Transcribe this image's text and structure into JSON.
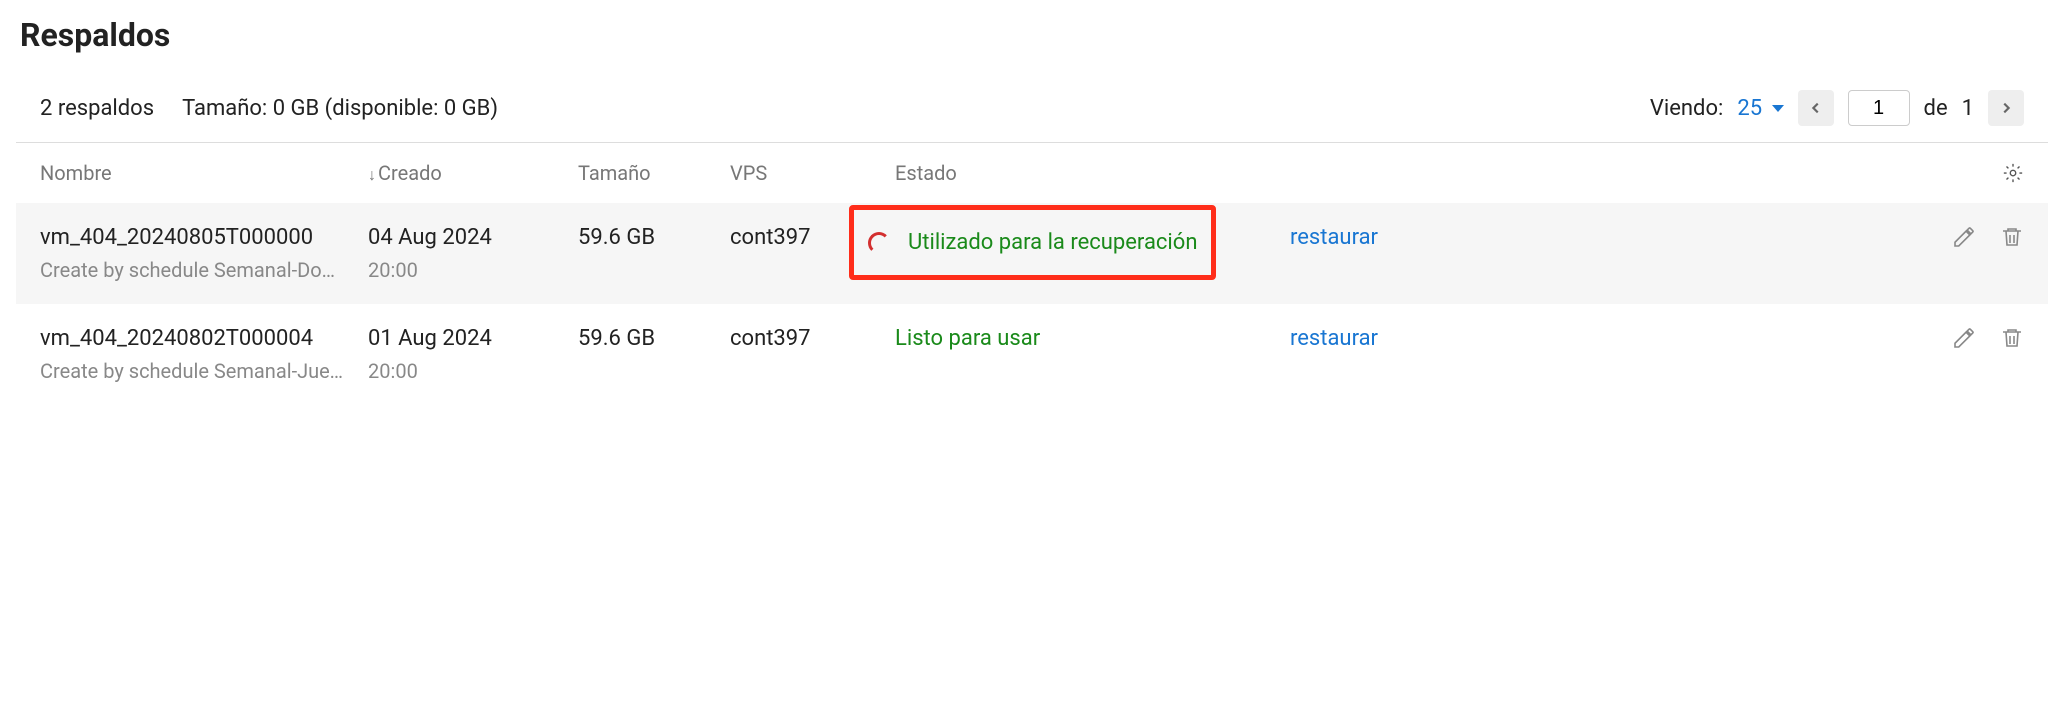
{
  "title": "Respaldos",
  "summary": {
    "count_label": "2 respaldos",
    "size_label": "Tamaño: 0 GB (disponible: 0 GB)"
  },
  "pagination": {
    "viewing_label": "Viendo:",
    "per_page": "25",
    "current_page": "1",
    "of_label": "de",
    "total_pages": "1"
  },
  "columns": {
    "name": "Nombre",
    "created": "Creado",
    "size": "Tamaño",
    "vps": "VPS",
    "status": "Estado"
  },
  "rows": [
    {
      "name": "vm_404_20240805T000000",
      "description": "Create by schedule Semanal-Domi…",
      "created_date": "04 Aug 2024",
      "created_time": "20:00",
      "size": "59.6 GB",
      "vps": "cont397",
      "status": "Utilizado para la recuperación",
      "has_spinner": true,
      "highlighted": true,
      "action": "restaurar"
    },
    {
      "name": "vm_404_20240802T000004",
      "description": "Create by schedule Semanal-Juev…",
      "created_date": "01 Aug 2024",
      "created_time": "20:00",
      "size": "59.6 GB",
      "vps": "cont397",
      "status": "Listo para usar",
      "has_spinner": false,
      "highlighted": false,
      "action": "restaurar"
    }
  ]
}
